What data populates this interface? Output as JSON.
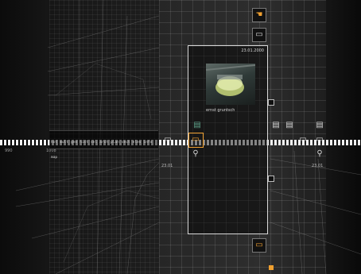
{
  "panel": {
    "date": "23.01.2000",
    "caption": "ernst gruntsch"
  },
  "timeline": {
    "left_label": "990",
    "mid_label": "1008",
    "left_date": "23.01",
    "right_date": "23.01"
  },
  "tags": [
    "hot",
    "mult",
    "gen",
    "hist",
    "sel",
    "arch",
    "plan",
    "sect",
    "elev",
    "info",
    "map"
  ],
  "icons": {
    "top_a": "hand-icon",
    "top_b": "folder-icon",
    "bottom": "folder-icon",
    "doc": "document-icon",
    "folder": "folder-icon",
    "person": "person-icon"
  },
  "colors": {
    "accent": "#f0a030",
    "panel_border": "#d8d8d8",
    "icon": "#d6d6d6"
  }
}
